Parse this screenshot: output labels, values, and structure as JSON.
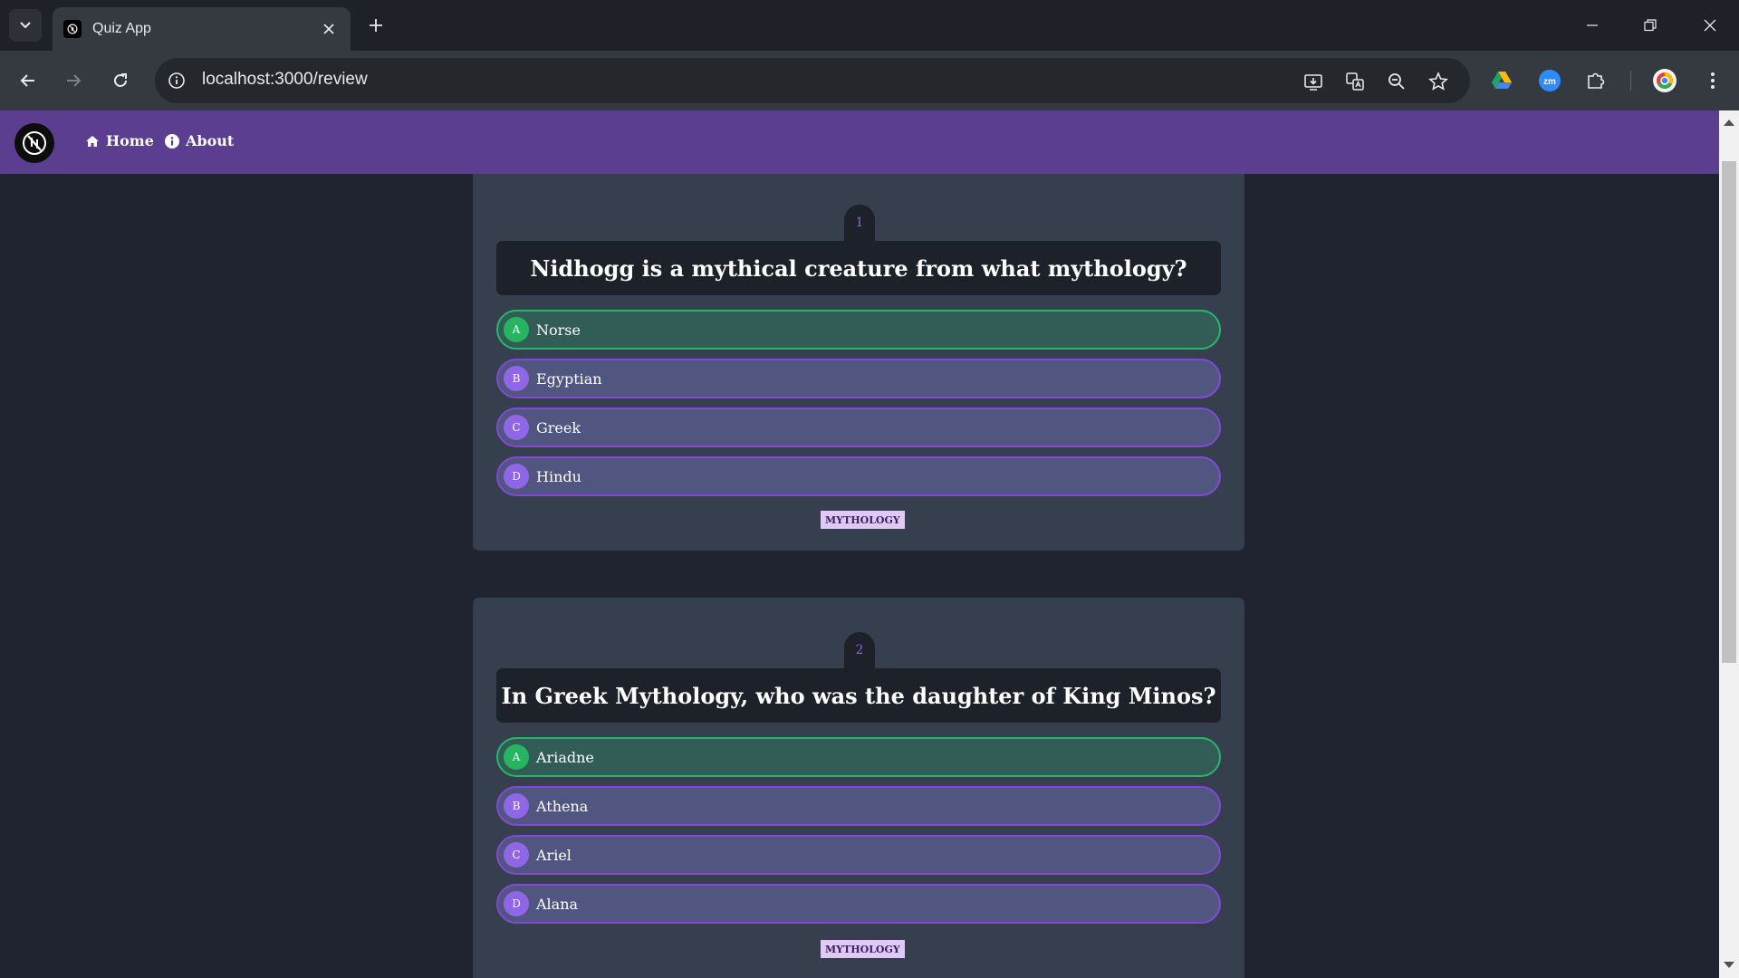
{
  "browser": {
    "tab_title": "Quiz App",
    "url": "localhost:3000/review"
  },
  "navbar": {
    "home_label": "Home",
    "about_label": "About",
    "brand_color": "#5b3e8f"
  },
  "questions": [
    {
      "number": "1",
      "text": "Nidhogg is a mythical creature from what mythology?",
      "options": [
        {
          "letter": "A",
          "text": "Norse",
          "correct": true
        },
        {
          "letter": "B",
          "text": "Egyptian",
          "correct": false
        },
        {
          "letter": "C",
          "text": "Greek",
          "correct": false
        },
        {
          "letter": "D",
          "text": "Hindu",
          "correct": false
        }
      ],
      "category": "MYTHOLOGY"
    },
    {
      "number": "2",
      "text": "In Greek Mythology, who was the daughter of King Minos?",
      "options": [
        {
          "letter": "A",
          "text": "Ariadne",
          "correct": true
        },
        {
          "letter": "B",
          "text": "Athena",
          "correct": false
        },
        {
          "letter": "C",
          "text": "Ariel",
          "correct": false
        },
        {
          "letter": "D",
          "text": "Alana",
          "correct": false
        }
      ],
      "category": "MYTHOLOGY"
    }
  ],
  "colors": {
    "correct_option": "#325c56",
    "default_option": "#515681",
    "card": "#353f4d",
    "page_bg": "#1f2430"
  }
}
